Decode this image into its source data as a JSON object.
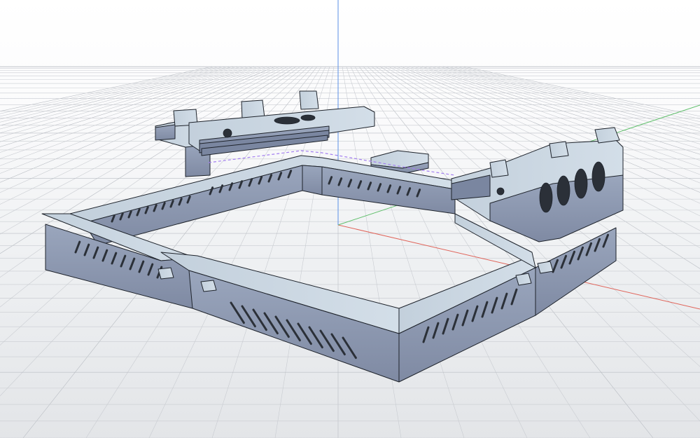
{
  "viewport": {
    "background_top": "#ffffff",
    "background_bottom": "#e3e5e8",
    "grid_color": "#c9ccd1",
    "grid_major_color": "#b9bdc3"
  },
  "axes": {
    "x_color": "#e0645a",
    "y_color": "#5fbf6b",
    "z_color": "#5a8fe6"
  },
  "model": {
    "body_color": "#aebccb",
    "top_color": "#c9d6e2",
    "side_color": "#8f9db4",
    "dark_side_color": "#7a86a0",
    "edge_color": "#1e232b",
    "slot_color": "#2b3038",
    "highlight_color": "#a37ef0"
  }
}
